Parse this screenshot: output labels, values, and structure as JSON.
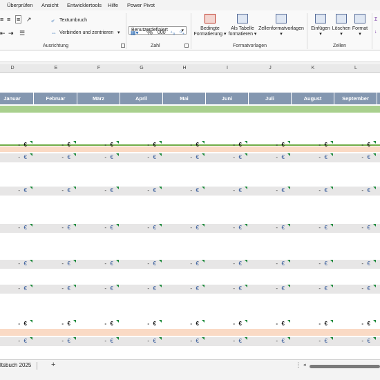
{
  "menu": [
    "Überprüfen",
    "Ansicht",
    "Entwicklertools",
    "Hilfe",
    "Power Pivot"
  ],
  "ribbon": {
    "textumbruch": "Textumbruch",
    "verbinden": "Verbinden und zentrieren",
    "ausrichtung": "Ausrichtung",
    "number_format": "Benutzerdefiniert",
    "zahl": "Zahl",
    "bedingte_1": "Bedingte",
    "bedingte_2": "Formatierung",
    "als_tabelle_1": "Als Tabelle",
    "als_tabelle_2": "formatieren",
    "zellenformat": "Zellenformatvorlagen",
    "formatvorlagen": "Formatvorlagen",
    "einfuegen": "Einfügen",
    "loeschen": "Löschen",
    "format": "Format",
    "zellen": "Zellen",
    "percent": "%",
    "comma": "000"
  },
  "columns": [
    "D",
    "E",
    "F",
    "G",
    "H",
    "I",
    "J",
    "K",
    "L"
  ],
  "months": [
    "Januar",
    "Februar",
    "März",
    "April",
    "Mai",
    "Juni",
    "Juli",
    "August",
    "September"
  ],
  "cell": {
    "dash": "-",
    "euro": "€"
  },
  "sheet_tab": "ltsbuch 2025",
  "add_sheet": "+",
  "colors": {
    "month_header": "#8497b0",
    "green_band": "#a9d08e",
    "green_line": "#70ad47",
    "pink_row": "#f8cbad",
    "gray_row": "#e7e6e6"
  }
}
